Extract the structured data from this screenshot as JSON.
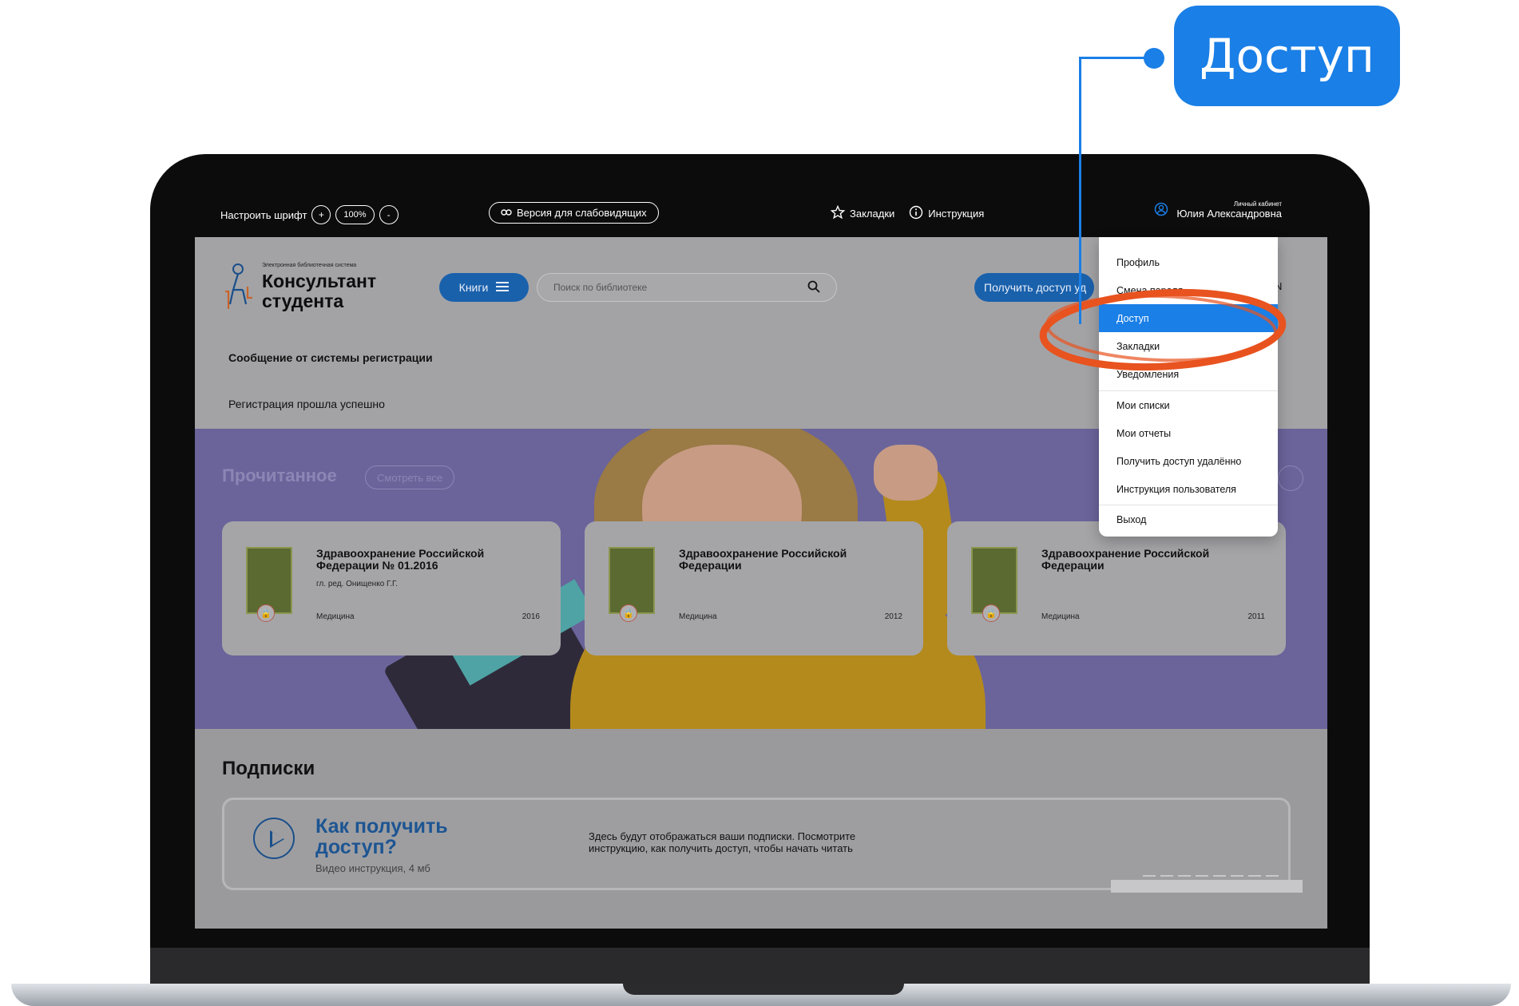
{
  "callout": {
    "label": "Доступ"
  },
  "topbar": {
    "font_label": "Настроить шрифт",
    "font_plus": "+",
    "font_zoom": "100%",
    "font_minus": "-",
    "vision_label": "Версия для слабовидящих",
    "bookmarks_label": "Закладки",
    "instruction_label": "Инструкция",
    "cabinet_label": "Личный кабинет",
    "user_name": "Юлия Александровна"
  },
  "header": {
    "logo_small": "Электронная библиотечная система",
    "logo_line1": "Консультант",
    "logo_line2": "студента",
    "books_button": "Книги",
    "search_placeholder": "Поиск по библиотеке",
    "access_button": "Получить доступ уд",
    "edge_letter": "N"
  },
  "message": {
    "title": "Сообщение от системы регистрации",
    "text": "Регистрация прошла успешно"
  },
  "read": {
    "title": "Прочитанное",
    "see_all": "Смотреть все",
    "cards": [
      {
        "title": "Здравоохранение Российской Федерации № 01.2016",
        "author": "гл. ред. Онищенко Г.Г.",
        "category": "Медицина",
        "year": "2016"
      },
      {
        "title": "Здравоохранение Российской Федерации",
        "author": "",
        "category": "Медицина",
        "year": "2012"
      },
      {
        "title": "Здравоохранение Российской Федерации",
        "author": "",
        "category": "Медицина",
        "year": "2011"
      }
    ]
  },
  "subscriptions": {
    "title": "Подписки",
    "how_title": "Как получить доступ?",
    "how_sub": "Видео инструкция, 4 мб",
    "text": "Здесь будут отображаться ваши подписки. Посмотрите инструкцию, как получить доступ, чтобы начать читать"
  },
  "dropdown": {
    "items": [
      "Профиль",
      "Смена пароля",
      "Доступ",
      "Закладки",
      "Уведомления",
      "Мои списки",
      "Мои отчеты",
      "Получить доступ удалённо",
      "Инструкция пользователя",
      "Выход"
    ],
    "active_index": 2
  },
  "colors": {
    "accent": "#1a7fe6",
    "highlight_circle": "#e8531f"
  }
}
